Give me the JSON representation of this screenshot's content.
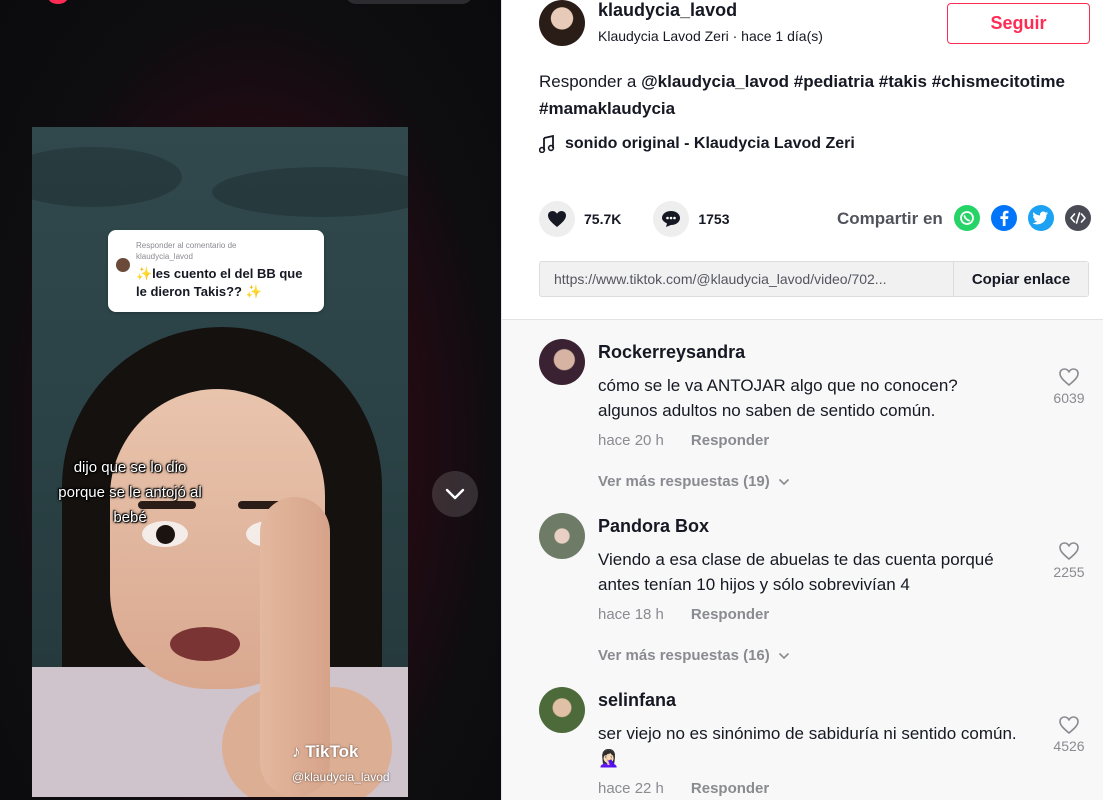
{
  "video": {
    "reply_card": {
      "header": "Responder al comentario de",
      "username": "klaudycia_lavod",
      "text": "✨les cuento el del BB que le dieron Takis?? ✨"
    },
    "caption": "dijo que se lo dio porque se le antojó al bebé",
    "watermark": {
      "brand": "TikTok",
      "user": "@klaudycia_lavod"
    },
    "nav_down_icon": "chevron-down-icon"
  },
  "author": {
    "username": "klaudycia_lavod",
    "display": "Klaudycia Lavod Zeri · hace 1 día(s)",
    "follow_label": "Seguir"
  },
  "description": {
    "prefix": "Responder a",
    "mention": "@klaudycia_lavod",
    "hashtags": "#pediatria #takis #chismecitotime #mamaklaudycia"
  },
  "music": {
    "label": "sonido original - Klaudycia Lavod Zeri",
    "icon": "music-note-icon"
  },
  "stats": {
    "likes": "75.7K",
    "comments": "1753"
  },
  "share": {
    "label": "Compartir en",
    "icons": [
      "whatsapp-icon",
      "facebook-icon",
      "twitter-icon",
      "embed-icon"
    ],
    "colors": {
      "whatsapp": "#25d366",
      "facebook": "#0075fa",
      "twitter": "#1da1f2",
      "embed": "#4a4b54"
    }
  },
  "link": {
    "url": "https://www.tiktok.com/@klaudycia_lavod/video/702...",
    "copy_label": "Copiar enlace"
  },
  "comments": [
    {
      "user": "Rockerreysandra",
      "text": "cómo se le va ANTOJAR algo que no conocen? algunos adultos no saben de sentido común.",
      "time": "hace 20 h",
      "reply_label": "Responder",
      "likes": "6039",
      "more": "Ver más respuestas (19)"
    },
    {
      "user": "Pandora Box",
      "text": "Viendo a esa clase de abuelas te das cuenta porqué antes tenían 10 hijos y sólo sobrevivían 4",
      "time": "hace 18 h",
      "reply_label": "Responder",
      "likes": "2255",
      "more": "Ver más respuestas (16)"
    },
    {
      "user": "selinfana",
      "text": "ser viejo no es sinónimo de sabiduría ni sentido común. 🤦🏻‍♀️",
      "time": "hace 22 h",
      "reply_label": "Responder",
      "likes": "4526"
    }
  ],
  "colors": {
    "accent": "#fe2c55",
    "text": "#161823",
    "muted": "#8a8b91"
  }
}
